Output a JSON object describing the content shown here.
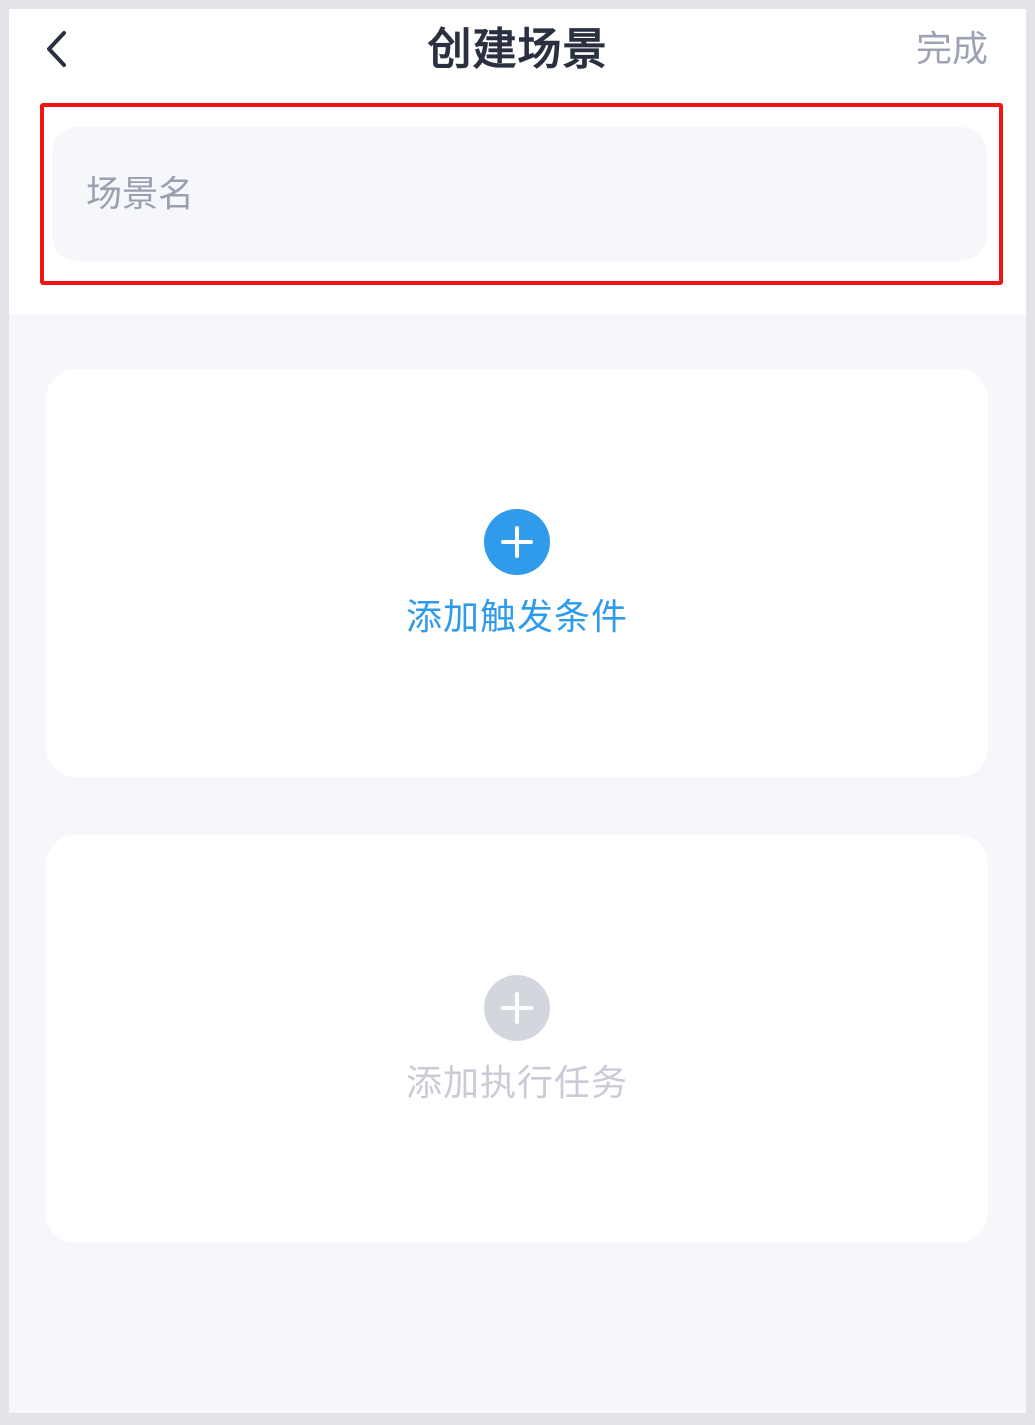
{
  "nav": {
    "title": "创建场景",
    "done_label": "完成",
    "back_icon": "chevron-left-icon"
  },
  "scene_name": {
    "placeholder": "场景名",
    "value": ""
  },
  "trigger_card": {
    "label": "添加触发条件",
    "icon": "plus-circle-icon",
    "icon_color": "#2f9bea",
    "label_color": "#2f9bea"
  },
  "task_card": {
    "label": "添加执行任务",
    "icon": "plus-circle-icon",
    "icon_color": "#d4d6de",
    "label_color": "#c9ccd6"
  },
  "colors": {
    "highlight_border": "#f01414",
    "page_background": "#f6f7fb",
    "title_text": "#2b3040"
  }
}
